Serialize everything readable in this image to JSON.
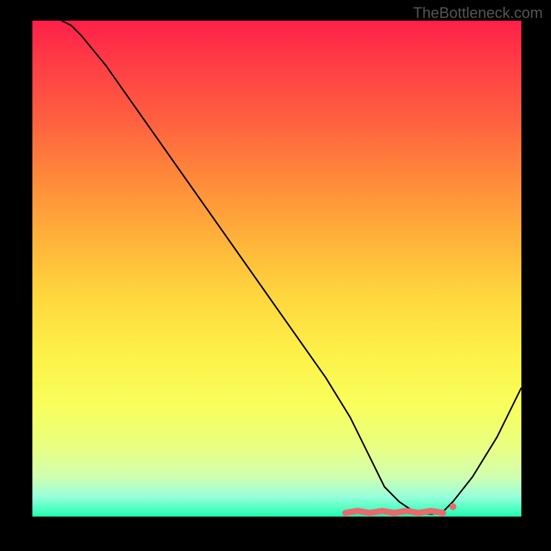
{
  "watermark": "TheBottleneck.com",
  "chart_data": {
    "type": "line",
    "title": "",
    "xlabel": "",
    "ylabel": "",
    "xlim": [
      0,
      100
    ],
    "ylim": [
      0,
      100
    ],
    "series": [
      {
        "name": "curve",
        "x": [
          6,
          8,
          10,
          15,
          20,
          30,
          40,
          50,
          60,
          65,
          68,
          70,
          72,
          75,
          78,
          80,
          82,
          84,
          86,
          90,
          95,
          100
        ],
        "y": [
          100,
          99,
          97,
          91,
          84,
          70,
          56,
          42,
          28,
          20,
          14,
          10,
          6,
          3,
          1,
          0.5,
          0.5,
          1,
          3,
          8,
          16,
          26
        ]
      }
    ],
    "markers": {
      "name": "highlight-band",
      "y_value": 1,
      "x_start": 64,
      "x_end": 84,
      "end_dot_x": 86,
      "end_dot_y": 2,
      "color": "#e86a6d"
    },
    "background": {
      "type": "vertical-gradient",
      "stops": [
        {
          "pos": 0,
          "color": "#ff1f49"
        },
        {
          "pos": 50,
          "color": "#ffc93c"
        },
        {
          "pos": 100,
          "color": "#1fffb0"
        }
      ]
    }
  }
}
